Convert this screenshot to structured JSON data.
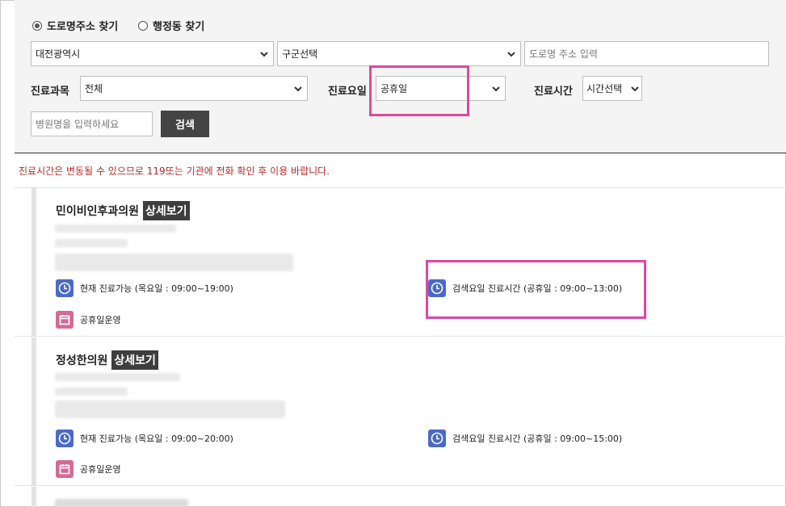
{
  "search": {
    "radio_road": "도로명주소 찾기",
    "radio_dong": "행정동 찾기",
    "city_select": "대전광역시",
    "district_select": "구군선택",
    "road_placeholder": "도로명 주소 입력",
    "dept_label": "진료과목",
    "dept_select": "전체",
    "day_label": "진료요일",
    "day_select": "공휴일",
    "time_label": "진료시간",
    "time_select": "시간선택",
    "hospital_placeholder": "병원명을 입력하세요",
    "search_button": "검색"
  },
  "notice": "진료시간은 변동될 수 있으므로 119또는 기관에 전화 확인 후 이용 바랍니다.",
  "results": [
    {
      "name": "민이비인후과의원",
      "detail_label": "상세보기",
      "current_hours": "현재 진료가능 (목요일 : 09:00~19:00)",
      "searched_hours": "검색요일 진료시간 (공휴일 : 09:00~13:00)",
      "holiday": "공휴일운영"
    },
    {
      "name": "정성한의원",
      "detail_label": "상세보기",
      "current_hours": "현재 진료가능 (목요일 : 09:00~20:00)",
      "searched_hours": "검색요일 진료시간 (공휴일 : 09:00~15:00)",
      "holiday": "공휴일운영"
    }
  ],
  "colors": {
    "accent_highlight": "#e0479e",
    "clock_icon": "#4a6ac8",
    "calendar_icon": "#d46a94",
    "notice_text": "#b82a2a"
  }
}
